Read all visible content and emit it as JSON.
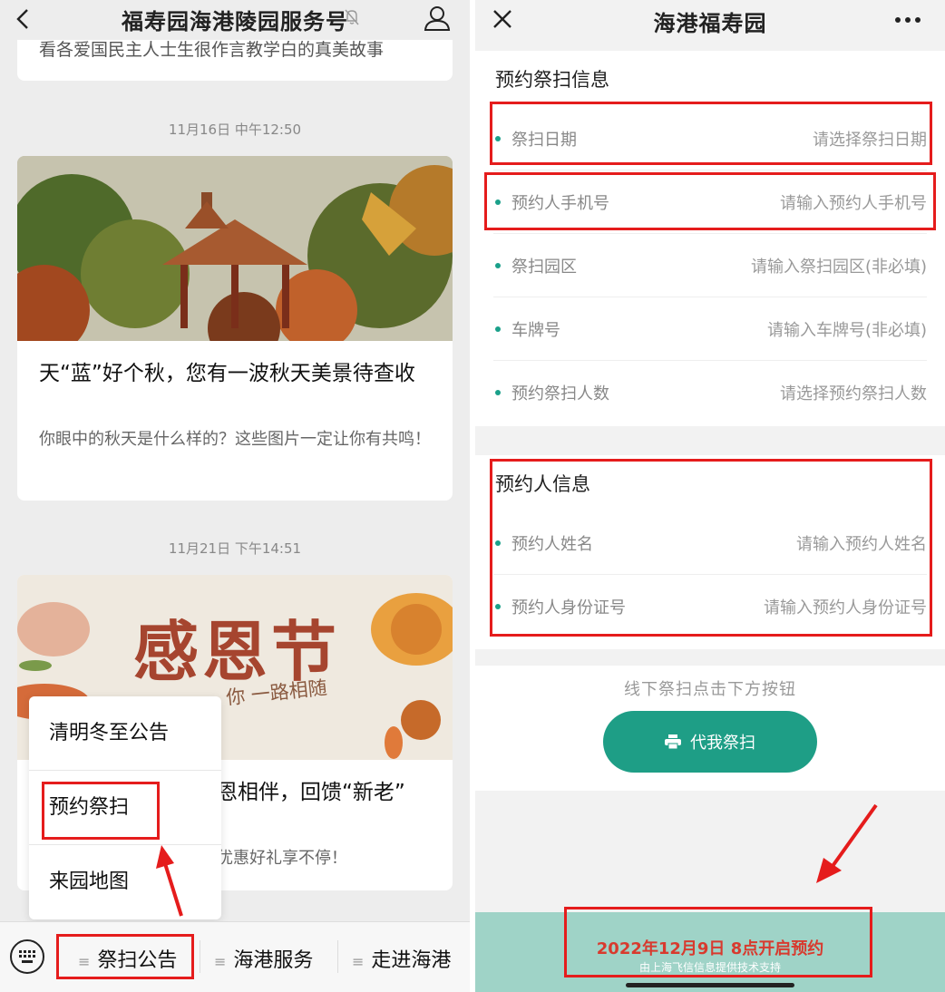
{
  "left": {
    "title": "福寿园海港陵园服务号",
    "cut_text": "看各爱国民主人士生很作言教学白的真美故事",
    "timestamp1": "11月16日 中午12:50",
    "article1": {
      "headline": "天“蓝”好个秋，您有一波秋天美景待查收",
      "desc": "你眼中的秋天是什么样的？这些图片一定让你有共鸣！"
    },
    "timestamp2": "11月21日 下午14:51",
    "article2": {
      "image_text": "感恩节",
      "image_subtext": "你 一路相随",
      "headline": "恩相伴，回馈“新老”",
      "desc": "优惠好礼享不停！"
    },
    "popup_menu": [
      "清明冬至公告",
      "预约祭扫",
      "来园地图"
    ],
    "tabbar": [
      "祭扫公告",
      "海港服务",
      "走进海港"
    ]
  },
  "right": {
    "title": "海港福寿园",
    "section1_title": "预约祭扫信息",
    "fields1": [
      {
        "label": "祭扫日期",
        "placeholder": "请选择祭扫日期"
      },
      {
        "label": "预约人手机号",
        "placeholder": "请输入预约人手机号"
      },
      {
        "label": "祭扫园区",
        "placeholder": "请输入祭扫园区(非必填)"
      },
      {
        "label": "车牌号",
        "placeholder": "请输入车牌号(非必填)"
      },
      {
        "label": "预约祭扫人数",
        "placeholder": "请选择预约祭扫人数"
      }
    ],
    "section2_title": "预约人信息",
    "fields2": [
      {
        "label": "预约人姓名",
        "placeholder": "请输入预约人姓名"
      },
      {
        "label": "预约人身份证号",
        "placeholder": "请输入预约人身份证号"
      }
    ],
    "hint": "线下祭扫点击下方按钮",
    "proxy_button": "代我祭扫",
    "open_notice": "2022年12月9日 8点开启预约",
    "support": "由上海飞信信息提供技术支持"
  },
  "colors": {
    "accent": "#1e9e86",
    "highlight": "#e51c1c",
    "footer": "#9fd3c7"
  }
}
